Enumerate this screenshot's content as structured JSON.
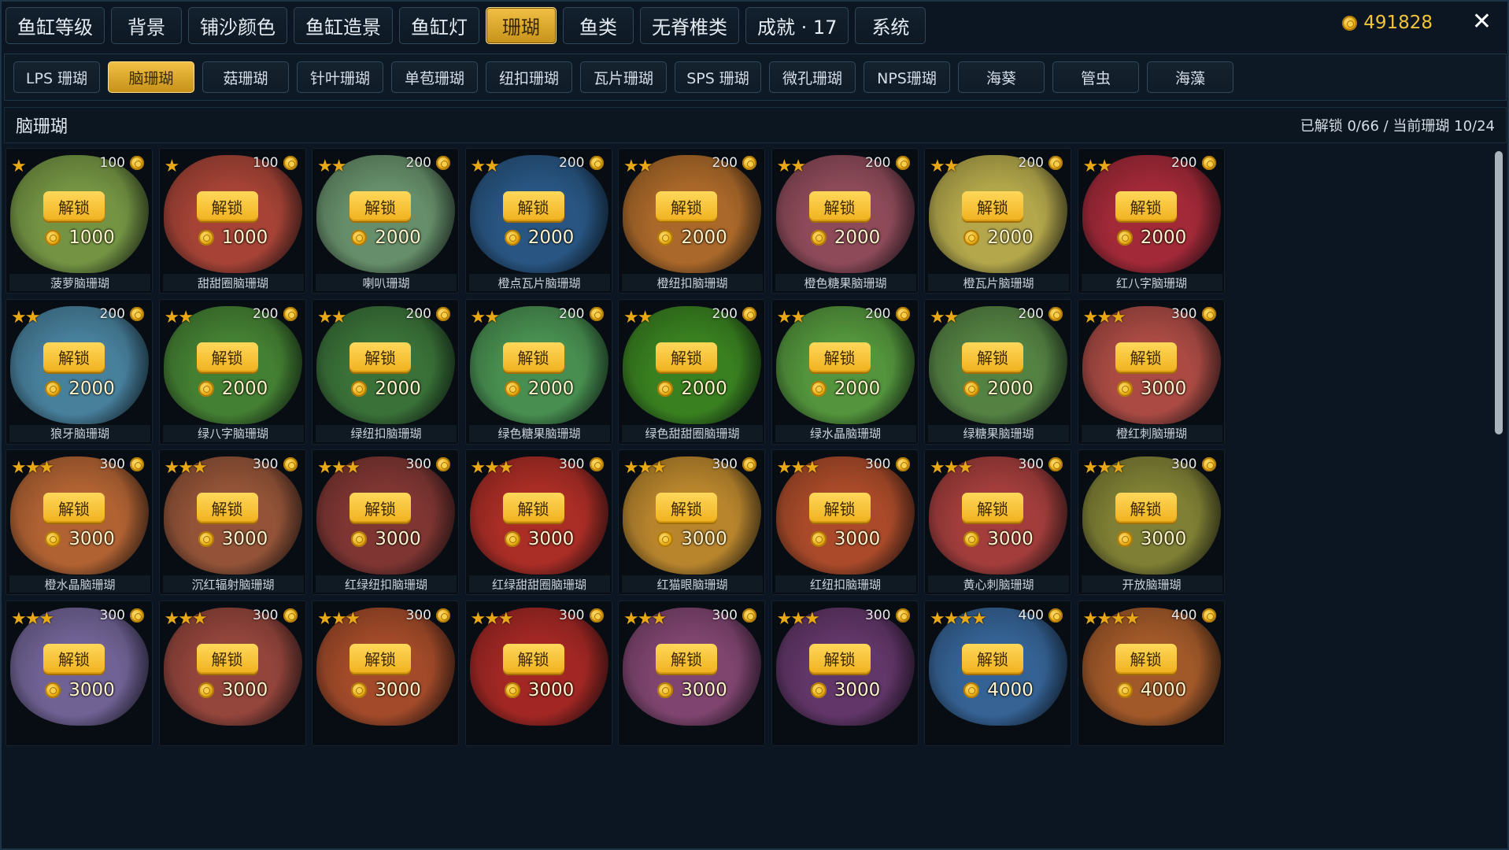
{
  "top_tabs": [
    "鱼缸等级",
    "背景",
    "铺沙颜色",
    "鱼缸造景",
    "鱼缸灯",
    "珊瑚",
    "鱼类",
    "无脊椎类",
    "成就 · 17",
    "系统"
  ],
  "top_active": 5,
  "coin_balance": "491828",
  "close_label": "✕",
  "sub_tabs": [
    "LPS 珊瑚",
    "脑珊瑚",
    "菇珊瑚",
    "针叶珊瑚",
    "单苞珊瑚",
    "纽扣珊瑚",
    "瓦片珊瑚",
    "SPS 珊瑚",
    "微孔珊瑚",
    "NPS珊瑚",
    "海葵",
    "管虫",
    "海藻"
  ],
  "sub_active": 1,
  "section_title": "脑珊瑚",
  "progress_text": "已解锁 0/66 / 当前珊瑚 10/24",
  "unlock_label": "解锁",
  "corals": [
    {
      "name": "菠萝脑珊瑚",
      "stars": "★",
      "cost": "100",
      "price": "1000",
      "color": "#7ea048"
    },
    {
      "name": "甜甜圈脑珊瑚",
      "stars": "★",
      "cost": "100",
      "price": "1000",
      "color": "#b4483a"
    },
    {
      "name": "喇叭珊瑚",
      "stars": "★★",
      "cost": "200",
      "price": "2000",
      "color": "#6f9a72"
    },
    {
      "name": "橙点瓦片脑珊瑚",
      "stars": "★★",
      "cost": "200",
      "price": "2000",
      "color": "#2c5c8c"
    },
    {
      "name": "橙纽扣脑珊瑚",
      "stars": "★★",
      "cost": "200",
      "price": "2000",
      "color": "#b8702c"
    },
    {
      "name": "橙色糖果脑珊瑚",
      "stars": "★★",
      "cost": "200",
      "price": "2000",
      "color": "#9a5060"
    },
    {
      "name": "橙瓦片脑珊瑚",
      "stars": "★★",
      "cost": "200",
      "price": "2000",
      "color": "#c2b450"
    },
    {
      "name": "红八字脑珊瑚",
      "stars": "★★",
      "cost": "200",
      "price": "2000",
      "color": "#b02c3c"
    },
    {
      "name": "狼牙脑珊瑚",
      "stars": "★★",
      "cost": "200",
      "price": "2000",
      "color": "#4e8aa8"
    },
    {
      "name": "绿八字脑珊瑚",
      "stars": "★★",
      "cost": "200",
      "price": "2000",
      "color": "#4a8a36"
    },
    {
      "name": "绿纽扣脑珊瑚",
      "stars": "★★",
      "cost": "200",
      "price": "2000",
      "color": "#3f7a3c"
    },
    {
      "name": "绿色糖果脑珊瑚",
      "stars": "★★",
      "cost": "200",
      "price": "2000",
      "color": "#4e9a56"
    },
    {
      "name": "绿色甜甜圈脑珊瑚",
      "stars": "★★",
      "cost": "200",
      "price": "2000",
      "color": "#3e8a22"
    },
    {
      "name": "绿水晶脑珊瑚",
      "stars": "★★",
      "cost": "200",
      "price": "2000",
      "color": "#5aa040"
    },
    {
      "name": "绿糖果脑珊瑚",
      "stars": "★★",
      "cost": "200",
      "price": "2000",
      "color": "#5c8c48"
    },
    {
      "name": "橙红刺脑珊瑚",
      "stars": "★★★",
      "cost": "300",
      "price": "3000",
      "color": "#b85048"
    },
    {
      "name": "橙水晶脑珊瑚",
      "stars": "★★★",
      "cost": "300",
      "price": "3000",
      "color": "#c06a36"
    },
    {
      "name": "沉红辐射脑珊瑚",
      "stars": "★★★",
      "cost": "300",
      "price": "3000",
      "color": "#a05a3c"
    },
    {
      "name": "红绿纽扣脑珊瑚",
      "stars": "★★★",
      "cost": "300",
      "price": "3000",
      "color": "#8a3a36"
    },
    {
      "name": "红绿甜甜圈脑珊瑚",
      "stars": "★★★",
      "cost": "300",
      "price": "3000",
      "color": "#b83028"
    },
    {
      "name": "红猫眼脑珊瑚",
      "stars": "★★★",
      "cost": "300",
      "price": "3000",
      "color": "#c89030"
    },
    {
      "name": "红纽扣脑珊瑚",
      "stars": "★★★",
      "cost": "300",
      "price": "3000",
      "color": "#b8502c"
    },
    {
      "name": "黄心刺脑珊瑚",
      "stars": "★★★",
      "cost": "300",
      "price": "3000",
      "color": "#b04240"
    },
    {
      "name": "开放脑珊瑚",
      "stars": "★★★",
      "cost": "300",
      "price": "3000",
      "color": "#8a8a38"
    },
    {
      "name": "",
      "stars": "★★★",
      "cost": "300",
      "price": "3000",
      "color": "#7a6aa0"
    },
    {
      "name": "",
      "stars": "★★★",
      "cost": "300",
      "price": "3000",
      "color": "#a04a40"
    },
    {
      "name": "",
      "stars": "★★★",
      "cost": "300",
      "price": "3000",
      "color": "#b0502c"
    },
    {
      "name": "",
      "stars": "★★★",
      "cost": "300",
      "price": "3000",
      "color": "#b02a26"
    },
    {
      "name": "",
      "stars": "★★★",
      "cost": "300",
      "price": "3000",
      "color": "#8a4a78"
    },
    {
      "name": "",
      "stars": "★★★",
      "cost": "300",
      "price": "3000",
      "color": "#6a3a70"
    },
    {
      "name": "",
      "stars": "★★★★",
      "cost": "400",
      "price": "4000",
      "color": "#3a6aa0"
    },
    {
      "name": "",
      "stars": "★★★★",
      "cost": "400",
      "price": "4000",
      "color": "#b0602c"
    }
  ]
}
